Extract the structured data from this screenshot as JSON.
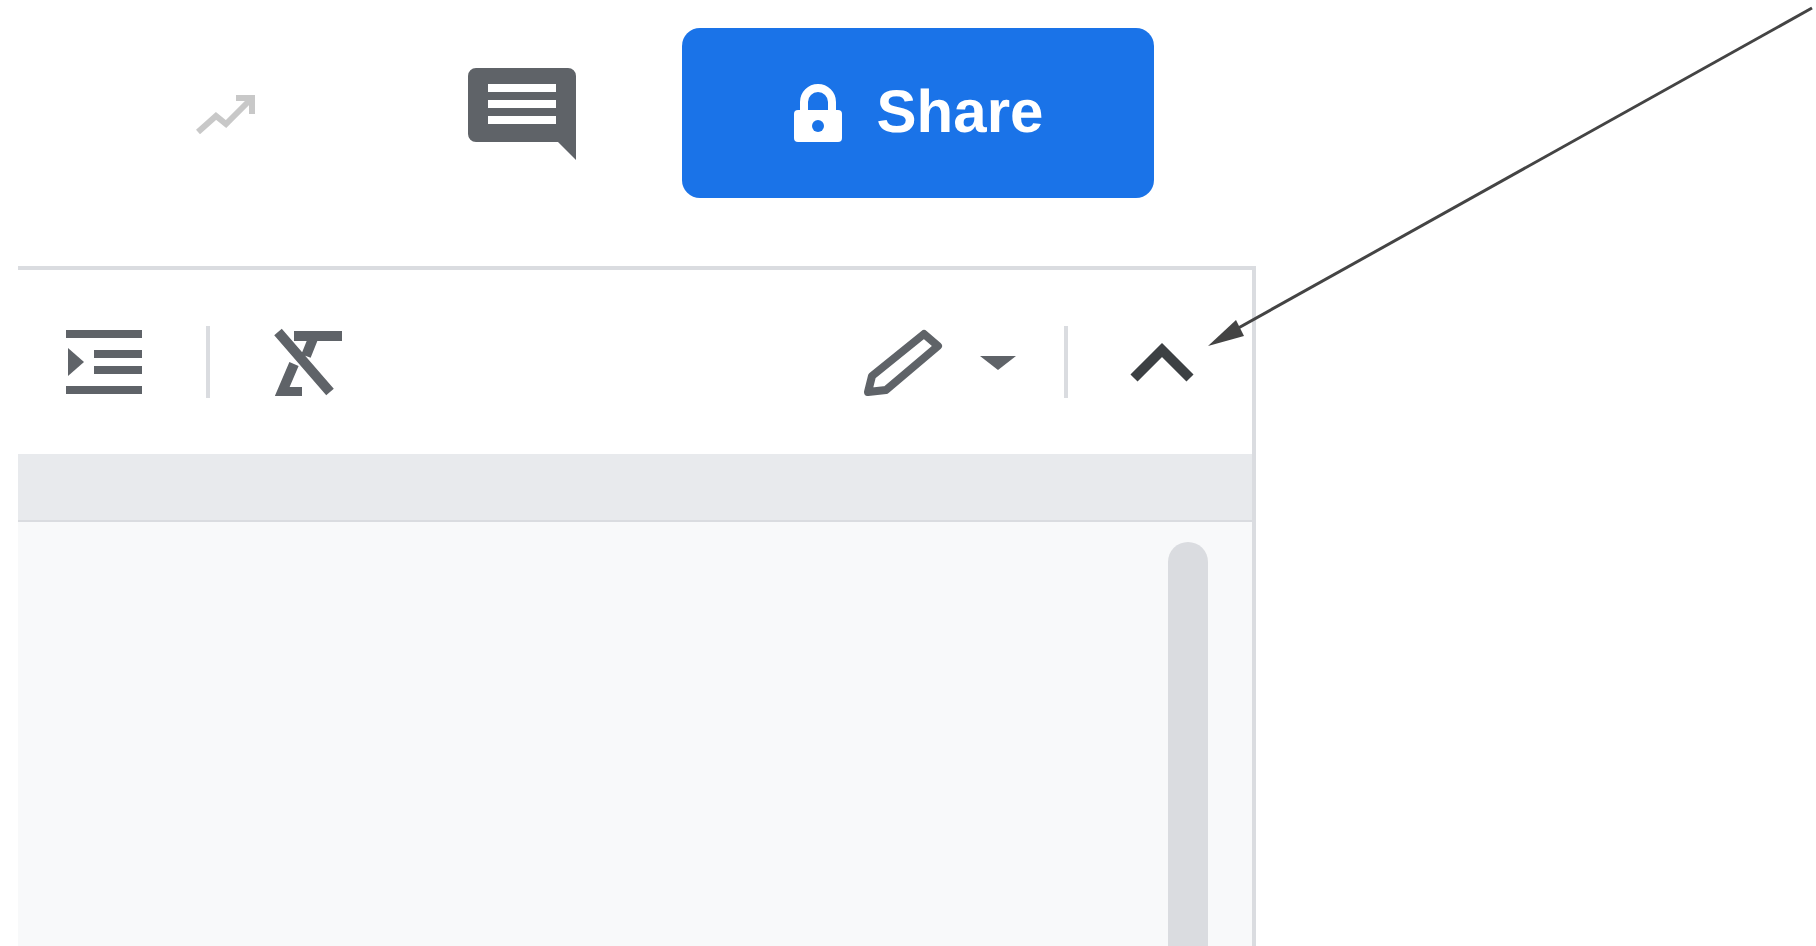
{
  "share_button": {
    "label": "Share"
  }
}
